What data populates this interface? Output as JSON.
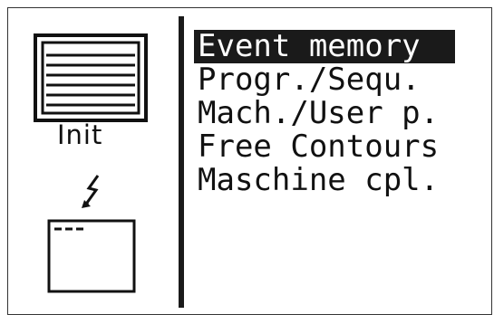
{
  "panel": {
    "init_label": "Init",
    "icons": [
      "document-icon",
      "lightning-arrow-icon",
      "window-icon"
    ]
  },
  "menu": {
    "items": [
      {
        "label": "Event memory",
        "selected": true
      },
      {
        "label": "Progr./Sequ.",
        "selected": false
      },
      {
        "label": "Mach./User p.",
        "selected": false
      },
      {
        "label": "Free Contours",
        "selected": false
      },
      {
        "label": "Maschine cpl.",
        "selected": false
      }
    ]
  },
  "colors": {
    "foreground": "#111111",
    "background": "#ffffff",
    "highlight": "#1a1a1a"
  }
}
